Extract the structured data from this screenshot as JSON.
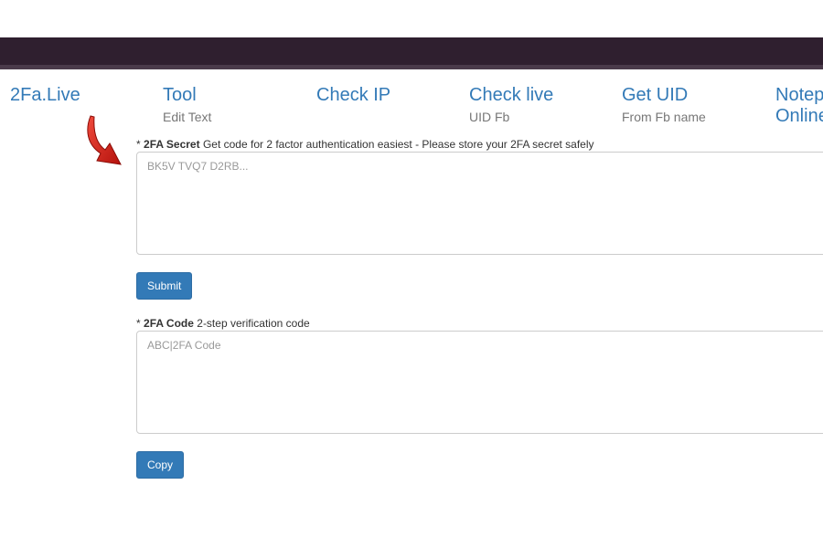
{
  "header": {
    "bar_color": "#2f1f2f"
  },
  "nav": {
    "brand": "2Fa.Live",
    "items": [
      {
        "label": "Tool",
        "sub": "Edit Text"
      },
      {
        "label": "Check IP",
        "sub": ""
      },
      {
        "label": "Check live",
        "sub": "UID Fb"
      },
      {
        "label": "Get UID",
        "sub": "From Fb name"
      },
      {
        "label": "Notep",
        "sub": "Online"
      }
    ]
  },
  "secret": {
    "required_mark": "*",
    "label": "2FA Secret",
    "description": "Get code for 2 factor authentication easiest - Please store your 2FA secret safely",
    "value": "",
    "placeholder": "BK5V TVQ7 D2RB...",
    "submit_label": "Submit"
  },
  "code": {
    "required_mark": "*",
    "label": "2FA Code",
    "description": "2-step verification code",
    "value": "",
    "placeholder": "ABC|2FA Code",
    "copy_label": "Copy"
  },
  "colors": {
    "link": "#337ab7",
    "muted": "#777777",
    "button": "#337ab7",
    "arrow": "#e0201a"
  },
  "icons": {
    "pointer": "red-curved-arrow-icon"
  }
}
